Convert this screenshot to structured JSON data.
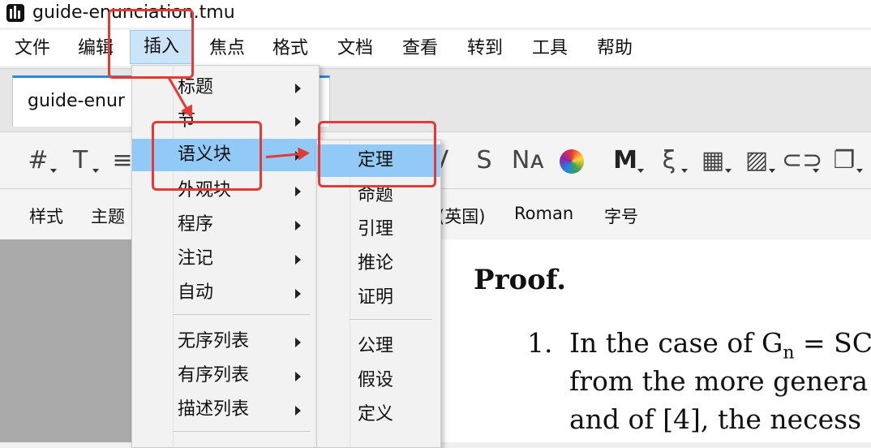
{
  "window": {
    "title": "guide-enunciation.tmu"
  },
  "menubar": [
    "文件",
    "编辑",
    "插入",
    "焦点",
    "格式",
    "文档",
    "查看",
    "转到",
    "工具",
    "帮助"
  ],
  "tab": {
    "label": "guide-enur"
  },
  "toolbar1": {
    "icons": [
      "hash-icon",
      "insert-text-icon",
      "align-icon",
      "v-icon",
      "sans-serif-icon",
      "small-caps-icon",
      "color-wheel-icon",
      "math-m-icon",
      "xi-icon",
      "table-icon",
      "image-icon",
      "link-icon",
      "copy-icon"
    ]
  },
  "toolbar2": {
    "style": "样式",
    "theme": "主题",
    "language": "(英国)",
    "font": "Roman",
    "size": "字号"
  },
  "insert_menu": {
    "items": [
      {
        "label": "标题",
        "submenu": true
      },
      {
        "label": "节",
        "submenu": true
      },
      {
        "label": "语义块",
        "submenu": true,
        "highlighted": true
      },
      {
        "label": "外观块",
        "submenu": true
      },
      {
        "label": "程序",
        "submenu": true
      },
      {
        "label": "注记",
        "submenu": true
      },
      {
        "label": "自动",
        "submenu": true
      },
      {
        "label": "无序列表",
        "submenu": true
      },
      {
        "label": "有序列表",
        "submenu": true
      },
      {
        "label": "描述列表",
        "submenu": true
      }
    ]
  },
  "semantic_submenu": {
    "items": [
      {
        "label": "定理",
        "highlighted": true
      },
      {
        "label": "命题"
      },
      {
        "label": "引理"
      },
      {
        "label": "推论"
      },
      {
        "label": "证明"
      },
      {
        "label": "公理"
      },
      {
        "label": "假设"
      },
      {
        "label": "定义"
      }
    ]
  },
  "document": {
    "heading": "Proof.",
    "line1_num": "1.",
    "line1": "In the case of G",
    "line1_sub": "n",
    "line1_end": " = SC",
    "line2": "from the more genera",
    "line3": "and of [4], the necess"
  },
  "colors": {
    "highlight": "#91c9f7",
    "annotation": "#e53935",
    "tab_accent": "#2a8ad4"
  }
}
